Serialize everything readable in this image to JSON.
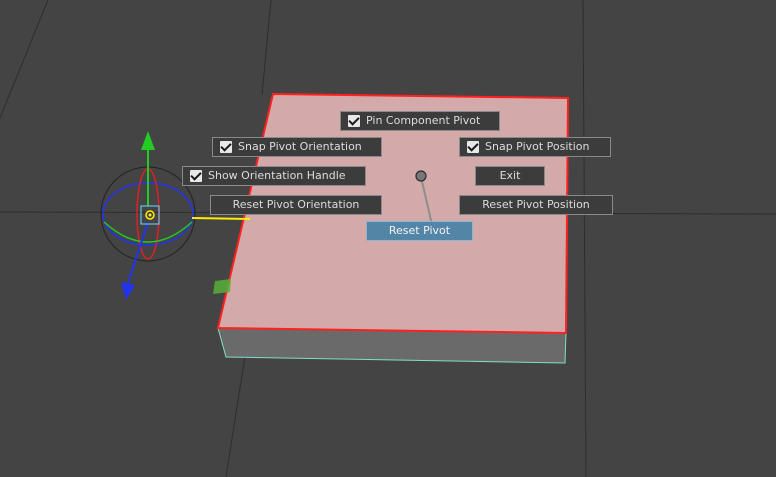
{
  "colors": {
    "viewport_bg": "#444444",
    "grid_line": "#2e2e2e",
    "face_fill": "#d4a9aa",
    "face_edge": "#ff2020",
    "side_fill": "#6a6a6a",
    "side_edge": "#7fe0c8",
    "axis_y": "#22cc22",
    "axis_z": "#2233ee",
    "axis_x": "#dd2222",
    "pivot_center": "#ffee00",
    "button_bg": "#3c3c3c",
    "button_selected_bg": "#5285a6"
  },
  "manipulator": {
    "icons": [
      "move-y-arrow-icon",
      "move-z-arrow-icon",
      "rotate-ring-icon",
      "pivot-center-icon",
      "plane-handle-icon"
    ]
  },
  "marking_menu": {
    "items": [
      {
        "id": "pin-component-pivot",
        "label": "Pin Component Pivot",
        "checked": true
      },
      {
        "id": "snap-pivot-orientation",
        "label": "Snap Pivot Orientation",
        "checked": true
      },
      {
        "id": "snap-pivot-position",
        "label": "Snap Pivot Position",
        "checked": true
      },
      {
        "id": "show-orientation-handle",
        "label": "Show Orientation Handle",
        "checked": true
      },
      {
        "id": "exit",
        "label": "Exit"
      },
      {
        "id": "reset-pivot-orientation",
        "label": "Reset Pivot Orientation"
      },
      {
        "id": "reset-pivot-position",
        "label": "Reset Pivot Position"
      },
      {
        "id": "reset-pivot",
        "label": "Reset Pivot",
        "selected": true
      }
    ]
  }
}
